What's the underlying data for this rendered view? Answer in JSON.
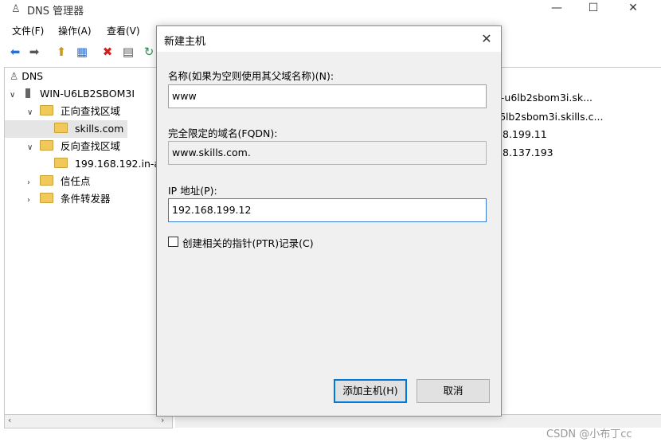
{
  "window": {
    "title": "DNS 管理器",
    "minimize": "—",
    "maximize": "☐",
    "close": "✕"
  },
  "menu": [
    "文件(F)",
    "操作(A)",
    "查看(V)"
  ],
  "tree": {
    "root": "DNS",
    "server": "WIN-U6LB2SBOM3I",
    "forward_zone": "正向查找区域",
    "forward_child": "skills.com",
    "reverse_zone": "反向查找区域",
    "reverse_child": "199.168.192.in-a",
    "trust_points": "信任点",
    "conditional_forwarders": "条件转发器"
  },
  "right_list": [
    "n-u6lb2sbom3i.sk...",
    "6lb2sbom3i.skills.c...",
    "8.199.11",
    "8.137.193"
  ],
  "dialog": {
    "title": "新建主机",
    "close": "✕",
    "name_label": "名称(如果为空则使用其父域名称)(N):",
    "name_value": "www",
    "fqdn_label": "完全限定的域名(FQDN):",
    "fqdn_value": "www.skills.com.",
    "ip_label": "IP 地址(P):",
    "ip_value": "192.168.199.12",
    "ptr_label": "创建相关的指针(PTR)记录(C)",
    "add_button": "添加主机(H)",
    "cancel_button": "取消"
  },
  "watermark": "CSDN @小布丁cc"
}
